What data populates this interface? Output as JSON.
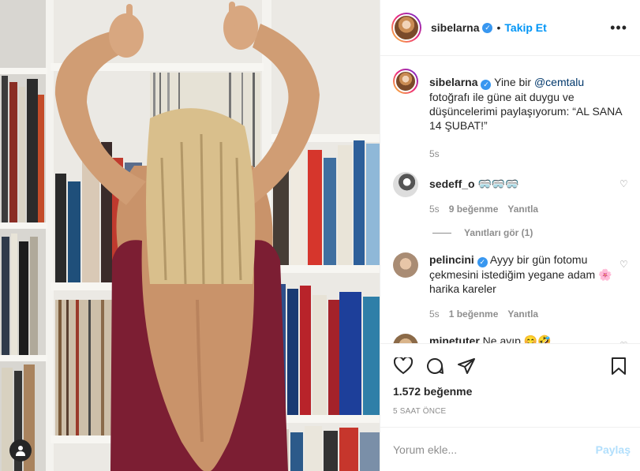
{
  "post": {
    "header": {
      "username": "sibelarna",
      "separator": "•",
      "follow_label": "Takip Et",
      "more_label": "•••"
    },
    "caption": {
      "username": "sibelarna",
      "text_before": " Yine bir ",
      "mention": "@cemtalu",
      "text_after": " fotoğrafı ile güne ait duygu ve düşüncelerimi paylaşıyorum: “AL SANA 14 ŞUBAT!”",
      "time": "5s"
    },
    "comments": [
      {
        "username": "sedeff_o",
        "text": " 🥽🥽🥽",
        "time": "5s",
        "likes": "9 beğenme",
        "reply_label": "Yanıtla",
        "view_replies": "Yanıtları gör (1)"
      },
      {
        "username": "pelincini",
        "text": " Ayyy bir gün fotomu çekmesini istediğim yegane adam 🌸 harika kareler",
        "time": "5s",
        "likes": "1 beğenme",
        "reply_label": "Yanıtla"
      },
      {
        "username": "minetuter",
        "text": " Ne ayıp 😊🤣"
      }
    ],
    "likes_text": "1.572 beğenme",
    "timestamp": "5 SAAT ÖNCE",
    "comment_input": {
      "placeholder": "Yorum ekle...",
      "share_label": "Paylaş"
    },
    "colors": {
      "accent": "#0095f6",
      "verified": "#3897f0",
      "share_disabled": "#b2dffc",
      "muted": "#8e8e8e"
    },
    "icons": [
      "verified-badge-icon",
      "more-icon",
      "heart-icon",
      "comment-icon",
      "share-icon",
      "bookmark-icon",
      "user-tag-icon"
    ]
  }
}
